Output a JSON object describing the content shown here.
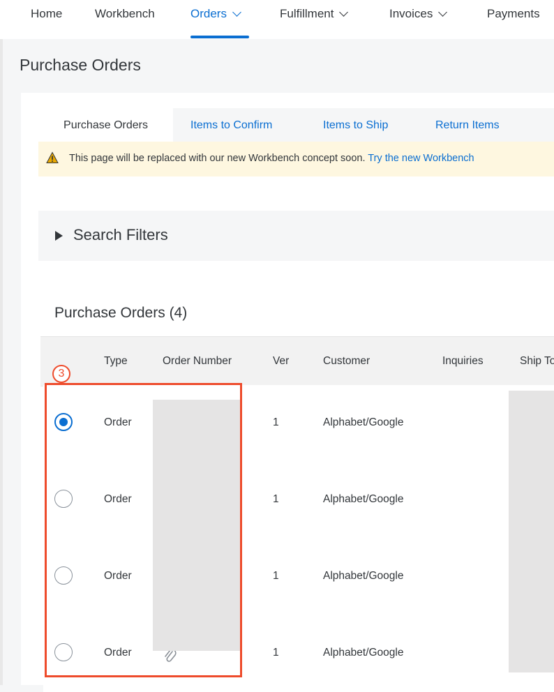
{
  "nav": {
    "items": [
      {
        "label": "Home",
        "dropdown": false,
        "active": false
      },
      {
        "label": "Workbench",
        "dropdown": false,
        "active": false
      },
      {
        "label": "Orders",
        "dropdown": true,
        "active": true
      },
      {
        "label": "Fulfillment",
        "dropdown": true,
        "active": false
      },
      {
        "label": "Invoices",
        "dropdown": true,
        "active": false
      },
      {
        "label": "Payments",
        "dropdown": false,
        "active": false
      }
    ]
  },
  "page": {
    "title": "Purchase Orders"
  },
  "subtabs": [
    {
      "label": "Purchase Orders",
      "active": true
    },
    {
      "label": "Items to Confirm",
      "active": false
    },
    {
      "label": "Items to Ship",
      "active": false
    },
    {
      "label": "Return Items",
      "active": false
    }
  ],
  "banner": {
    "icon": "warning-icon",
    "text": "This page will be replaced with our new Workbench concept soon.",
    "link": "Try the new Workbench"
  },
  "filters": {
    "label": "Search Filters",
    "icon": "triangle-right-icon"
  },
  "orders": {
    "title": "Purchase Orders (4)",
    "columns": [
      "Type",
      "Order Number",
      "Ver",
      "Customer",
      "Inquiries",
      "Ship To"
    ],
    "rows": [
      {
        "type": "Order",
        "ver": "1",
        "customer": "Alphabet/Google",
        "selected": true,
        "attachment": false
      },
      {
        "type": "Order",
        "ver": "1",
        "customer": "Alphabet/Google",
        "selected": false,
        "attachment": false
      },
      {
        "type": "Order",
        "ver": "1",
        "customer": "Alphabet/Google",
        "selected": false,
        "attachment": false
      },
      {
        "type": "Order",
        "ver": "1",
        "customer": "Alphabet/Google",
        "selected": false,
        "attachment": true
      }
    ]
  },
  "annotation": {
    "step": "3",
    "color": "#ee4b2b"
  },
  "colors": {
    "accent": "#0a6ed1",
    "banner_bg": "#fef7e0",
    "warning": "#e9a800"
  }
}
